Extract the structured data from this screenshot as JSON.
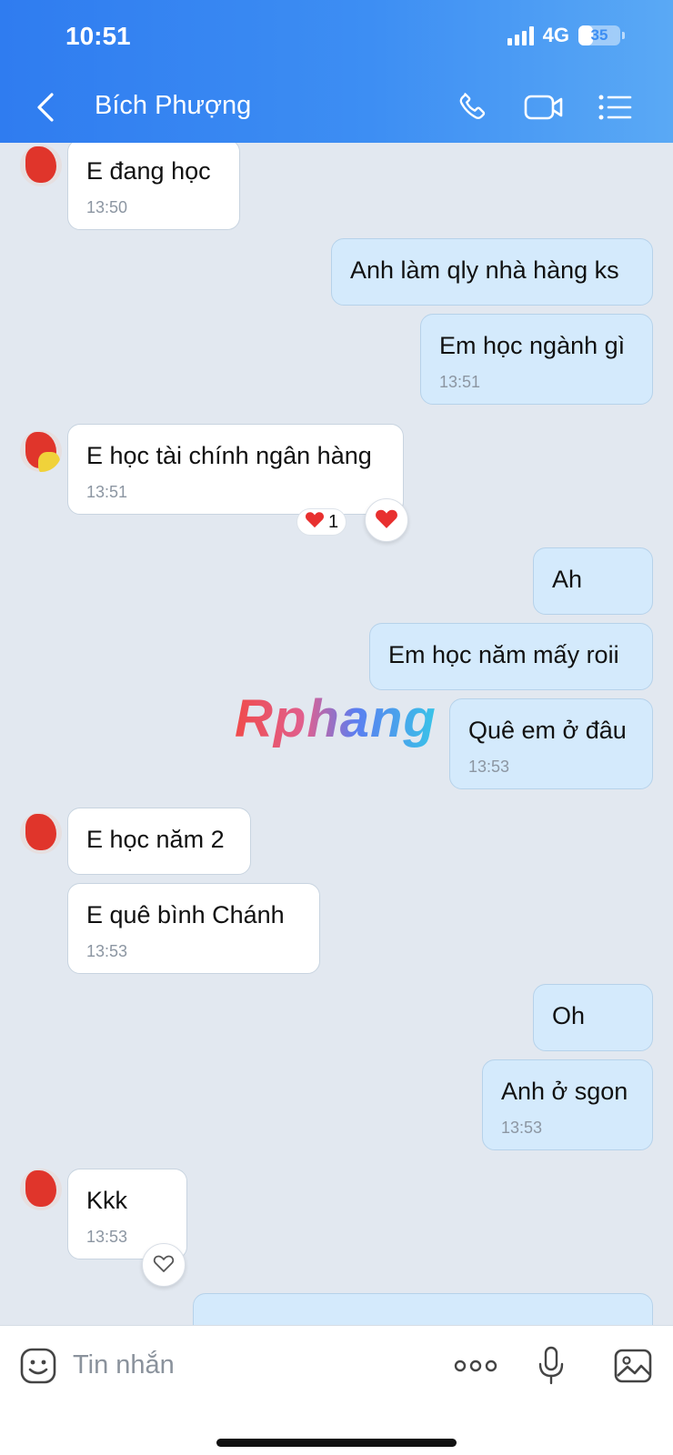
{
  "status": {
    "time": "10:51",
    "network": "4G",
    "battery": "35",
    "battery_level": 0.35
  },
  "header": {
    "contact_name": "Bích Phượng"
  },
  "icons": {
    "back": "chevron-left-icon",
    "call": "phone-icon",
    "video": "video-camera-icon",
    "menu": "list-menu-icon",
    "emoji": "emoji-icon",
    "more": "more-dots-icon",
    "mic": "microphone-icon",
    "image": "image-icon"
  },
  "colors": {
    "header_start": "#2f7cf0",
    "header_end": "#5aa9f5",
    "outgoing_bubble": "#d4eafc",
    "incoming_bubble": "#ffffff",
    "chat_bg": "#e2e8f0"
  },
  "messages": [
    {
      "dir": "in",
      "text": "E đang học",
      "time": "13:50"
    },
    {
      "dir": "out",
      "text": "Anh làm qly nhà hàng ks",
      "time": ""
    },
    {
      "dir": "out",
      "text": "Em học ngành gì",
      "time": "13:51"
    },
    {
      "dir": "in",
      "text": "E học tài chính ngân hàng",
      "time": "13:51",
      "reaction_count": "1"
    },
    {
      "dir": "out",
      "text": "Ah",
      "time": ""
    },
    {
      "dir": "out",
      "text": "Em học năm mấy roii",
      "time": ""
    },
    {
      "dir": "out",
      "text": "Quê em ở đâu",
      "time": "13:53"
    },
    {
      "dir": "in",
      "text": "E học năm 2",
      "time": ""
    },
    {
      "dir": "in",
      "text": "E quê bình Chánh",
      "time": "13:53"
    },
    {
      "dir": "out",
      "text": "Oh",
      "time": ""
    },
    {
      "dir": "out",
      "text": "Anh ở sgon",
      "time": "13:53"
    },
    {
      "dir": "in",
      "text": "Kkk",
      "time": "13:53"
    }
  ],
  "watermark": "Rphang",
  "composer": {
    "placeholder": "Tin nhắn"
  }
}
